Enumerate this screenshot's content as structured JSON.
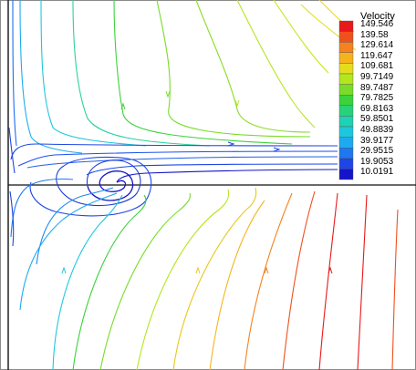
{
  "legend": {
    "title": "Velocity",
    "levels": [
      {
        "label": "149.546",
        "color": "#e8191a"
      },
      {
        "label": "139.58",
        "color": "#f0501e"
      },
      {
        "label": "129.614",
        "color": "#f5821e"
      },
      {
        "label": "119.647",
        "color": "#f5b41e"
      },
      {
        "label": "109.681",
        "color": "#e6dc1e"
      },
      {
        "label": "99.7149",
        "color": "#b4e61e"
      },
      {
        "label": "89.7487",
        "color": "#78dc28"
      },
      {
        "label": "79.7825",
        "color": "#3cd23c"
      },
      {
        "label": "69.8163",
        "color": "#28d278"
      },
      {
        "label": "59.8501",
        "color": "#1ed2b4"
      },
      {
        "label": "49.8839",
        "color": "#1ec8dc"
      },
      {
        "label": "39.9177",
        "color": "#1eaaf0"
      },
      {
        "label": "29.9515",
        "color": "#1e78f0"
      },
      {
        "label": "19.9053",
        "color": "#1e46e6"
      },
      {
        "label": "10.0191",
        "color": "#1414c8"
      }
    ]
  }
}
